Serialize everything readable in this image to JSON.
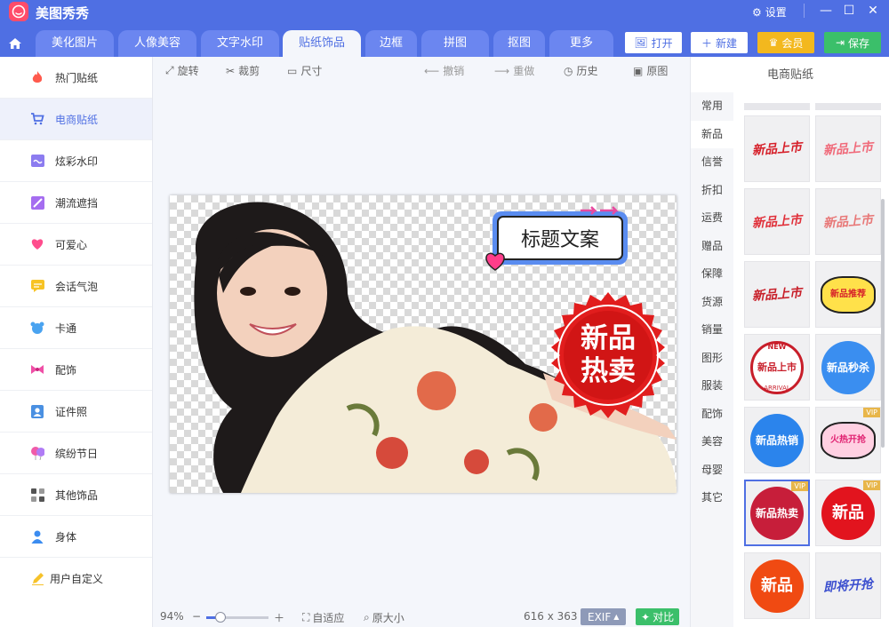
{
  "app": {
    "title": "美图秀秀",
    "settings_label": "设置"
  },
  "colors": {
    "brand": "#4f6fe3",
    "vip": "#f3b81e",
    "save": "#3bbf6a",
    "canvas_checker": "#d9d9d9"
  },
  "tabs": [
    {
      "label": "美化图片"
    },
    {
      "label": "人像美容"
    },
    {
      "label": "文字水印"
    },
    {
      "label": "贴纸饰品"
    },
    {
      "label": "边框"
    },
    {
      "label": "拼图"
    },
    {
      "label": "抠图"
    },
    {
      "label": "更多"
    }
  ],
  "actions": {
    "open": "打开",
    "new": "新建",
    "vip": "会员",
    "save": "保存"
  },
  "sidebar": [
    {
      "label": "热门贴纸",
      "icon": "flame-icon"
    },
    {
      "label": "电商贴纸",
      "icon": "cart-icon"
    },
    {
      "label": "炫彩水印",
      "icon": "watermark-icon"
    },
    {
      "label": "潮流遮挡",
      "icon": "mask-icon"
    },
    {
      "label": "可爱心",
      "icon": "heart-icon"
    },
    {
      "label": "会话气泡",
      "icon": "speech-bubble-icon"
    },
    {
      "label": "卡通",
      "icon": "bear-icon"
    },
    {
      "label": "配饰",
      "icon": "bow-icon"
    },
    {
      "label": "证件照",
      "icon": "id-photo-icon"
    },
    {
      "label": "缤纷节日",
      "icon": "balloon-icon"
    },
    {
      "label": "其他饰品",
      "icon": "grid-icon"
    },
    {
      "label": "身体",
      "icon": "person-icon"
    },
    {
      "label": "用户自定义",
      "icon": "pencil-icon"
    }
  ],
  "toolbar": {
    "rotate": "旋转",
    "crop": "裁剪",
    "size": "尺寸",
    "undo": "撤销",
    "redo": "重做",
    "history": "历史",
    "original": "原图"
  },
  "canvas": {
    "caption_sticker": "标题文案",
    "badge_line1": "新品",
    "badge_line2": "热卖"
  },
  "status": {
    "zoom": "94%",
    "fit": "自适应",
    "actual": "原大小",
    "dims": "616 x 363",
    "exif": "EXIF",
    "compare": "对比"
  },
  "right_panel": {
    "title": "电商贴纸",
    "categories": [
      "常用",
      "新品",
      "信誉",
      "折扣",
      "运费",
      "赠品",
      "保障",
      "货源",
      "销量",
      "图形",
      "服装",
      "配饰",
      "美容",
      "母婴",
      "其它"
    ],
    "active_category": "新品",
    "thumbs": [
      {
        "text": "新品上市",
        "vip": ""
      },
      {
        "text": "新品上市",
        "vip": ""
      },
      {
        "text": "新品上市",
        "vip": ""
      },
      {
        "text": "新品上市",
        "vip": ""
      },
      {
        "text": "新品上市",
        "vip": ""
      },
      {
        "text": "新品推荐",
        "vip": ""
      },
      {
        "text": "新品上市",
        "vip": "",
        "top": "NEW",
        "bottom": "ARRIVAL"
      },
      {
        "text": "新品秒杀",
        "vip": ""
      },
      {
        "text": "新品热销",
        "vip": ""
      },
      {
        "text": "火热开抢",
        "vip": "VIP"
      },
      {
        "text": "新品热卖",
        "vip": "VIP"
      },
      {
        "text": "新品",
        "vip": "VIP"
      },
      {
        "text": "新品",
        "vip": ""
      },
      {
        "text": "即将开抢",
        "vip": ""
      }
    ]
  }
}
